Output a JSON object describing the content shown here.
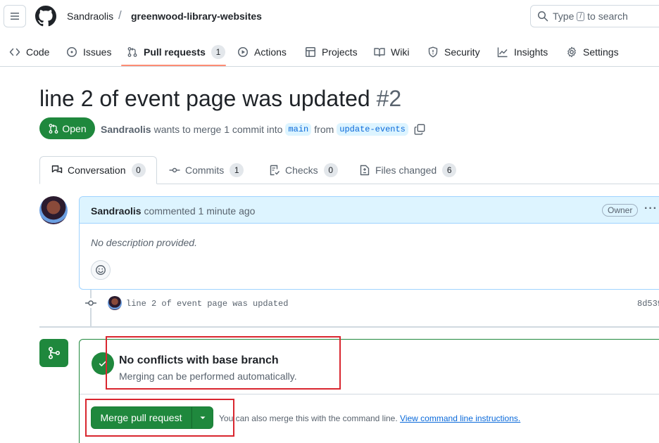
{
  "header": {
    "owner": "Sandraolis",
    "separator": "/",
    "repo": "greenwood-library-websites",
    "search_prefix": "Type",
    "search_key": "/",
    "search_suffix": "to search"
  },
  "nav": {
    "code": "Code",
    "issues": "Issues",
    "pulls": "Pull requests",
    "pulls_count": "1",
    "actions": "Actions",
    "projects": "Projects",
    "wiki": "Wiki",
    "security": "Security",
    "insights": "Insights",
    "settings": "Settings"
  },
  "pr": {
    "title": "line 2 of event page was updated",
    "number": "#2",
    "state": "Open",
    "author": "Sandraolis",
    "merge_text": "wants to merge 1 commit into",
    "base_branch": "main",
    "from_text": "from",
    "head_branch": "update-events"
  },
  "tabs": {
    "conversation": "Conversation",
    "conversation_count": "0",
    "commits": "Commits",
    "commits_count": "1",
    "checks": "Checks",
    "checks_count": "0",
    "files": "Files changed",
    "files_count": "6"
  },
  "comment": {
    "author": "Sandraolis",
    "action": "commented 1 minute ago",
    "role": "Owner",
    "menu": "···",
    "body": "No description provided."
  },
  "commit": {
    "message": "line 2 of event page was updated",
    "sha": "8d539"
  },
  "merge": {
    "status_title": "No conflicts with base branch",
    "status_sub": "Merging can be performed automatically.",
    "button": "Merge pull request",
    "cli_text": "You can also merge this with the command line.",
    "cli_link": "View command line instructions."
  },
  "colors": {
    "primary_green": "#1f883d",
    "link_blue": "#0969da",
    "active_tab_underline": "#fd8c73",
    "annotation_red": "#d9262f"
  }
}
